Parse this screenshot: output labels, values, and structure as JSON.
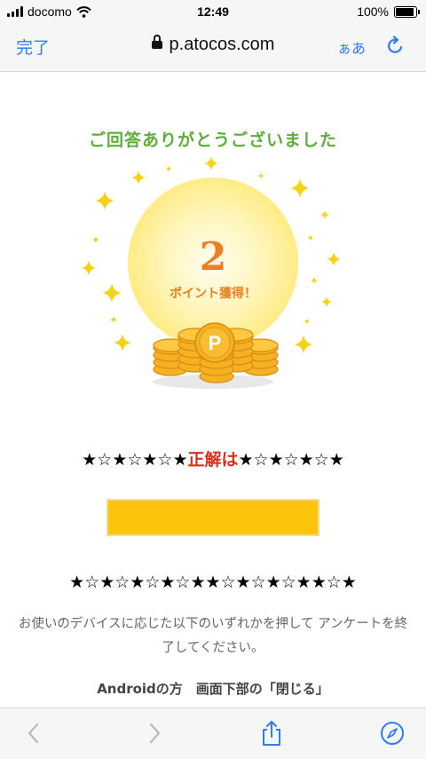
{
  "status_bar": {
    "carrier": "docomo",
    "time": "12:49",
    "battery_percent": "100%",
    "battery_level": 1.0
  },
  "browser": {
    "done_label": "完了",
    "url": "p.atocos.com",
    "text_size_label": "ぁあ",
    "icons": [
      "lock-icon",
      "reload-icon",
      "back-icon",
      "forward-icon",
      "share-icon",
      "compass-icon"
    ]
  },
  "content": {
    "title": "ご回答ありがとうございました",
    "points_number": "2",
    "points_label": "ポイント獲得！",
    "coin_label": "P",
    "answer_prefix": "★☆★☆★☆★",
    "answer_middle": "正解は",
    "answer_suffix": "★☆★☆★☆★",
    "stars_line": "★☆★☆★☆★☆★★☆★☆★☆★★☆★",
    "instruction": "お使いのデバイスに応じた以下のいずれかを押して アンケートを終了してください。",
    "android_line": "Androidの方　画面下部の「閉じる」"
  },
  "colors": {
    "accent_blue": "#2f7cf6",
    "title_green": "#5dae3a",
    "points_orange": "#ef7d22",
    "answer_red": "#d6311c",
    "answer_box": "#fcc40a",
    "sparkle": "#f7d313",
    "coin": "#f4b223"
  }
}
